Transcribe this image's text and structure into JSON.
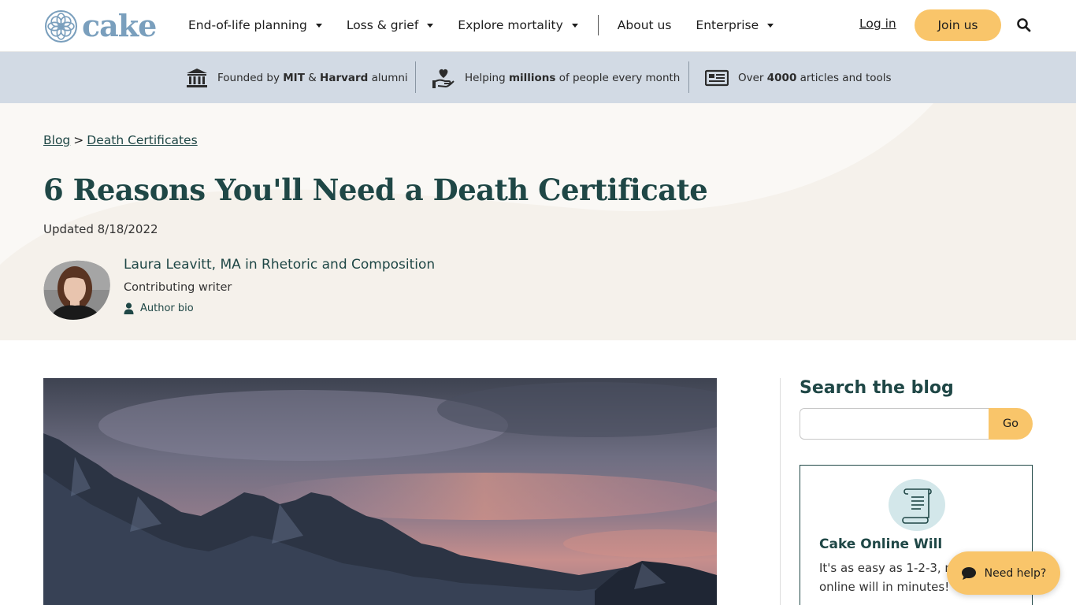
{
  "brand": {
    "name": "cake",
    "color": "#7a9fbd"
  },
  "nav": {
    "items": [
      {
        "label": "End-of-life planning",
        "dropdown": true
      },
      {
        "label": "Loss & grief",
        "dropdown": true
      },
      {
        "label": "Explore mortality",
        "dropdown": true
      },
      {
        "label": "About us",
        "dropdown": false
      },
      {
        "label": "Enterprise",
        "dropdown": true
      }
    ],
    "login_label": "Log in",
    "join_label": "Join us"
  },
  "trust": {
    "t1_pre": "Founded by ",
    "t1_b1": "MIT",
    "t1_mid": " & ",
    "t1_b2": "Harvard",
    "t1_post": " alumni",
    "t2_pre": "Helping ",
    "t2_b": "millions",
    "t2_post": " of people every month",
    "t3_pre": "Over ",
    "t3_b": "4000",
    "t3_post": " articles and tools"
  },
  "breadcrumb": {
    "item1": "Blog",
    "sep": ">",
    "item2": "Death Certificates"
  },
  "article": {
    "title": "6 Reasons You'll Need a Death Certificate",
    "updated": "Updated 8/18/2022"
  },
  "author": {
    "name": "Laura Leavitt, MA in Rhetoric and Composition",
    "role": "Contributing writer",
    "bio_label": "Author bio"
  },
  "sidebar": {
    "search_title": "Search the blog",
    "search_placeholder": "",
    "go_label": "Go",
    "card_title": "Cake Online Will",
    "card_text": "It's as easy as 1-2-3, make your online will in minutes!"
  },
  "help_label": "Need help?",
  "colors": {
    "accent": "#f9c56a",
    "teal": "#1f4746",
    "trust_bg": "#d2dae4",
    "hero_bg": "#faf8f5"
  }
}
